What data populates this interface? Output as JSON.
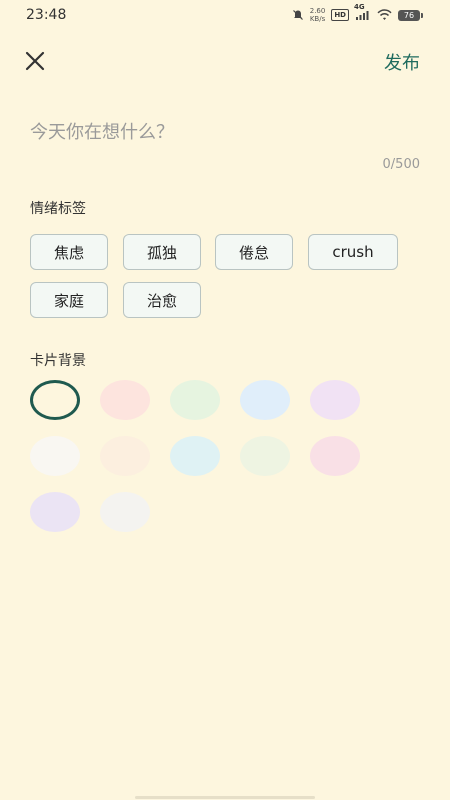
{
  "status_bar": {
    "time": "23:48",
    "net_speed_value": "2.60",
    "net_speed_unit": "KB/s",
    "hd_badge": "HD",
    "network_type": "4G",
    "battery": "76"
  },
  "header": {
    "publish_label": "发布"
  },
  "editor": {
    "placeholder": "今天你在想什么？",
    "value": "",
    "char_count": "0/500"
  },
  "mood_tags": {
    "title": "情绪标签",
    "items": [
      {
        "label": "焦虑"
      },
      {
        "label": "孤独"
      },
      {
        "label": "倦怠"
      },
      {
        "label": "crush"
      },
      {
        "label": "家庭"
      },
      {
        "label": "治愈"
      }
    ]
  },
  "card_background": {
    "title": "卡片背景",
    "selected_index": 0,
    "colors": [
      "#fdf6de",
      "#fde4de",
      "#e6f4e0",
      "#e0eefa",
      "#f1e2f4",
      "#f9f7f2",
      "#fcefdf",
      "#dff2f4",
      "#eef4e2",
      "#f9e0e6",
      "#ebe4f4",
      "#f4f3f0"
    ]
  },
  "colors": {
    "accent": "#1f6b5e",
    "page_background": "#fdf6de"
  }
}
